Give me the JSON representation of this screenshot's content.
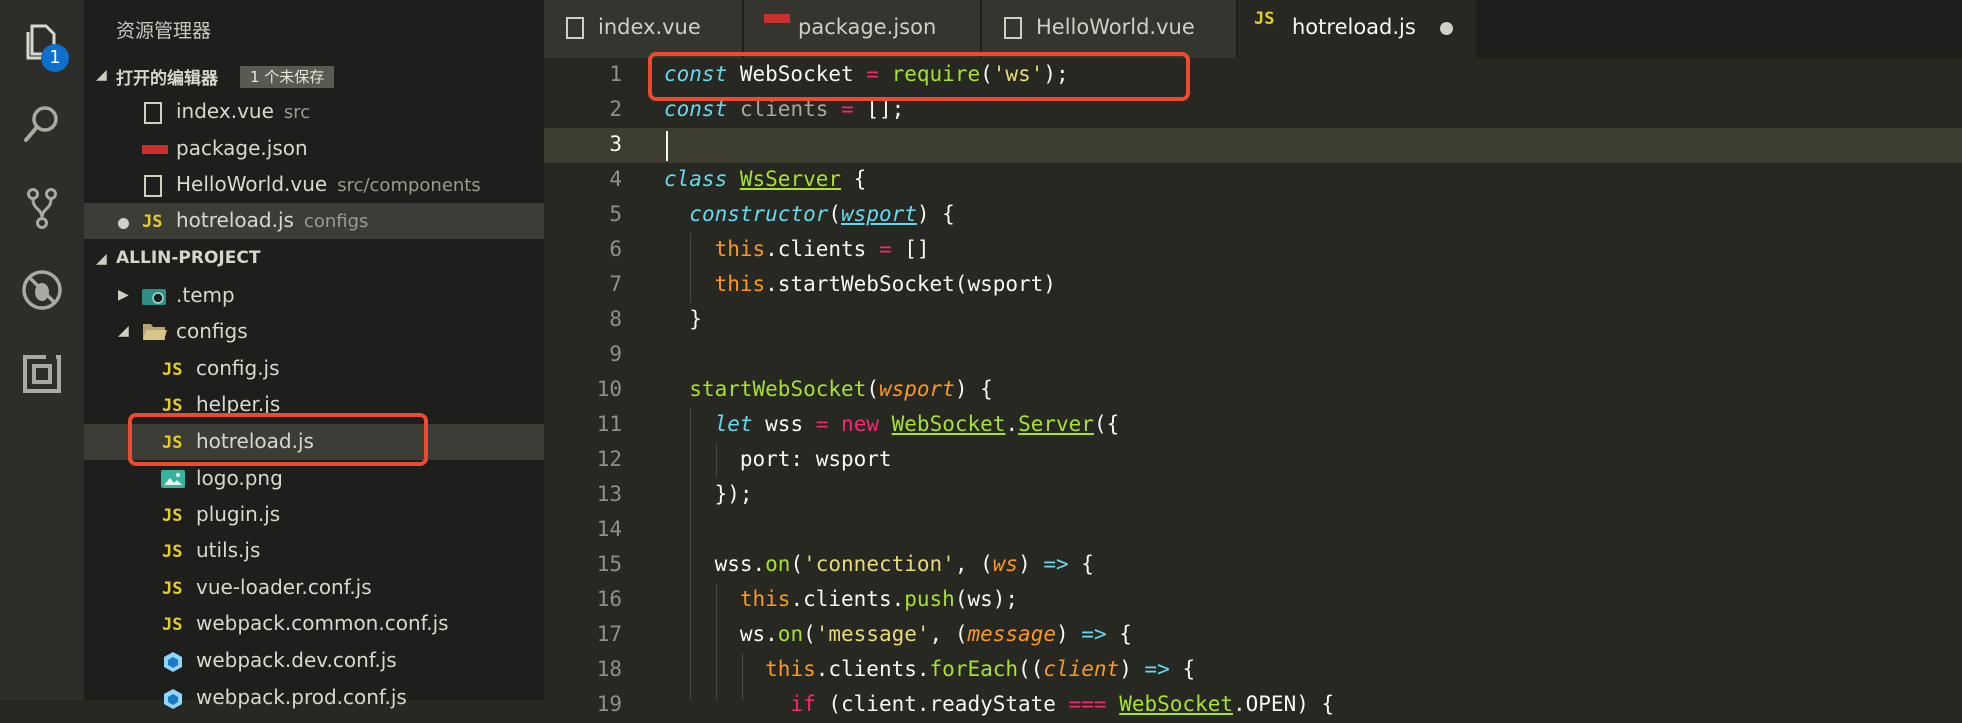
{
  "activity_bar": {
    "items": [
      {
        "icon": "explorer-icon"
      },
      {
        "icon": "search-icon"
      },
      {
        "icon": "source-control-icon"
      },
      {
        "icon": "debug-icon"
      },
      {
        "icon": "extensions-icon"
      }
    ],
    "badge": "1"
  },
  "sidebar": {
    "title": "资源管理器",
    "open_editors": {
      "header": "打开的编辑器",
      "badge": "1 个未保存",
      "items": [
        {
          "name": "index.vue",
          "desc": "src",
          "icon": "vue-file-icon"
        },
        {
          "name": "package.json",
          "desc": "",
          "icon": "npm-icon"
        },
        {
          "name": "HelloWorld.vue",
          "desc": "src/components",
          "icon": "vue-file-icon"
        },
        {
          "name": "hotreload.js",
          "desc": "configs",
          "icon": "js-icon",
          "unsaved": true
        }
      ]
    },
    "project": {
      "header": "ALLIN-PROJECT",
      "items": [
        {
          "name": ".temp",
          "type": "folder"
        },
        {
          "name": "configs",
          "type": "folder-open"
        },
        {
          "name": "config.js",
          "type": "js"
        },
        {
          "name": "helper.js",
          "type": "js"
        },
        {
          "name": "hotreload.js",
          "type": "js"
        },
        {
          "name": "logo.png",
          "type": "image"
        },
        {
          "name": "plugin.js",
          "type": "js"
        },
        {
          "name": "utils.js",
          "type": "js"
        },
        {
          "name": "vue-loader.conf.js",
          "type": "js"
        },
        {
          "name": "webpack.common.conf.js",
          "type": "js"
        },
        {
          "name": "webpack.dev.conf.js",
          "type": "webpack"
        },
        {
          "name": "webpack.prod.conf.js",
          "type": "webpack"
        }
      ]
    }
  },
  "tabs": [
    {
      "label": "index.vue",
      "icon": "vue-file-icon"
    },
    {
      "label": "package.json",
      "icon": "npm-icon"
    },
    {
      "label": "HelloWorld.vue",
      "icon": "vue-file-icon"
    },
    {
      "label": "hotreload.js",
      "icon": "js-icon",
      "active": true,
      "unsaved": true
    }
  ],
  "js_icon_text": "JS",
  "editor": {
    "line_numbers": [
      "1",
      "2",
      "3",
      "4",
      "5",
      "6",
      "7",
      "8",
      "9",
      "10",
      "11",
      "12",
      "13",
      "14",
      "15",
      "16",
      "17",
      "18",
      "19"
    ],
    "lines": [
      "const WebSocket = require('ws');",
      "const clients = [];",
      "",
      "class WsServer {",
      "  constructor(wsport) {",
      "    this.clients = []",
      "    this.startWebSocket(wsport)",
      "  }",
      "",
      "  startWebSocket(wsport) {",
      "    let wss = new WebSocket.Server({",
      "      port: wsport",
      "    });",
      "",
      "    wss.on('connection', (ws) => {",
      "      this.clients.push(ws);",
      "      ws.on('message', (message) => {",
      "        this.clients.forEach((client) => {",
      "          if (client.readyState === WebSocket.OPEN) {"
    ]
  }
}
